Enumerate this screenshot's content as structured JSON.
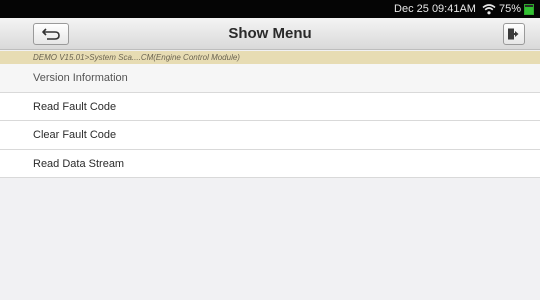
{
  "statusbar": {
    "datetime": "Dec 25 09:41AM",
    "battery_percent": "75%",
    "battery_level": 0.75,
    "wifi_icon": "wifi-icon",
    "battery_icon": "battery-icon"
  },
  "header": {
    "title": "Show Menu",
    "back_icon": "back-arrow-icon",
    "exit_icon": "exit-icon"
  },
  "breadcrumb": "DEMO V15.01>System Sca....CM(Engine Control Module)",
  "menu": {
    "items": [
      {
        "label": "Version Information"
      },
      {
        "label": "Read Fault Code"
      },
      {
        "label": "Clear Fault Code"
      },
      {
        "label": "Read Data Stream"
      }
    ]
  },
  "colors": {
    "status_bar": "#050505",
    "breadcrumb_bg": "#e7dcb3",
    "battery_green": "#33c233",
    "page_bg": "#f1f1f3"
  }
}
